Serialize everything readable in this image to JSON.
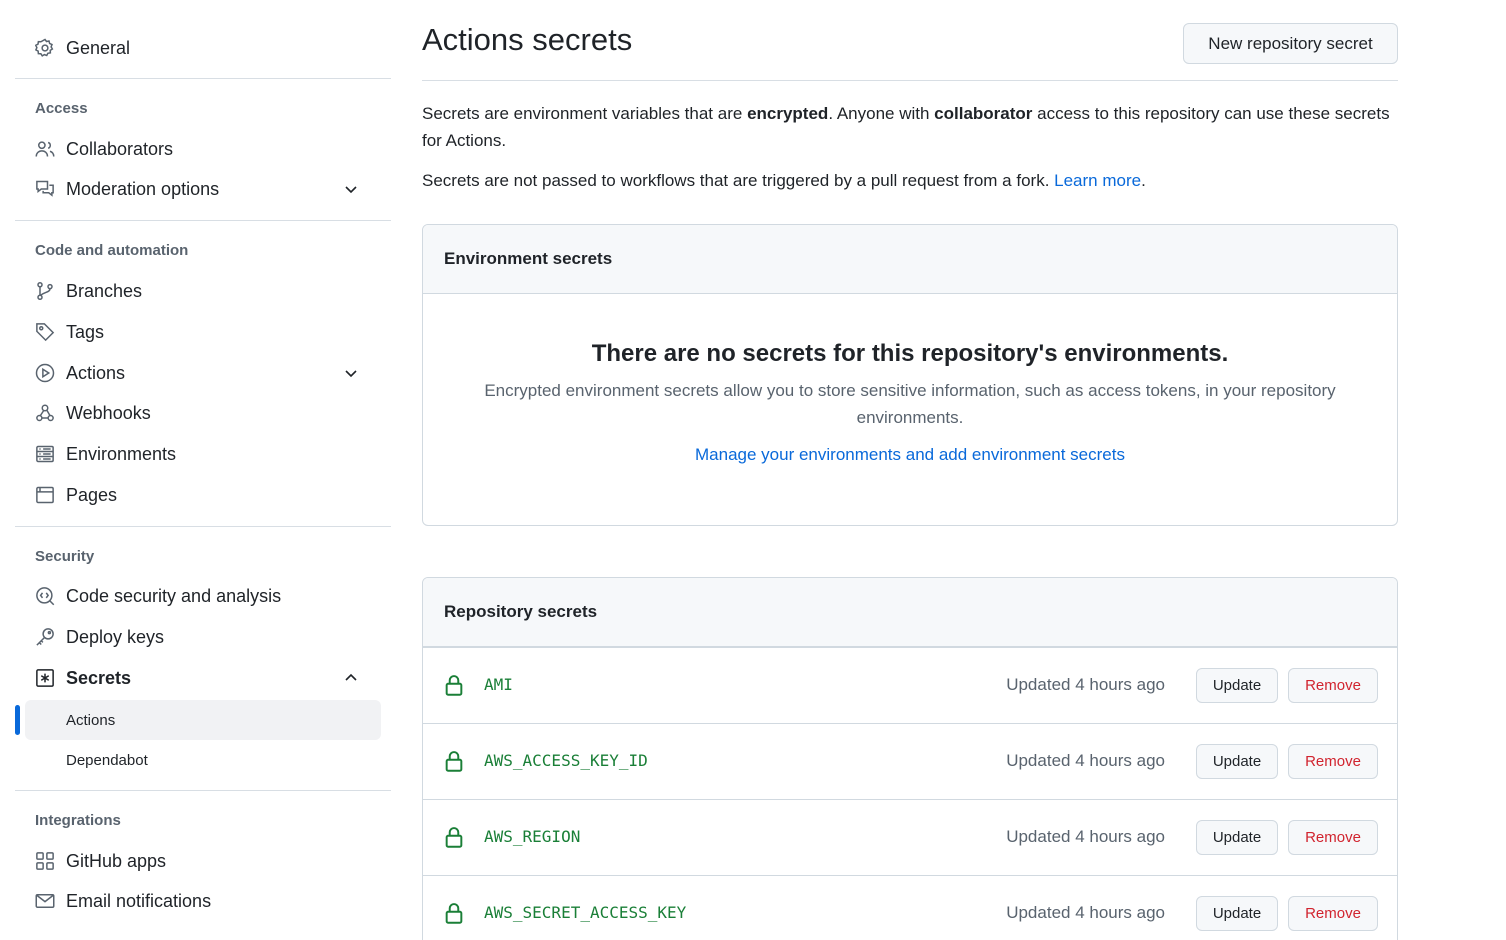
{
  "sidebar": {
    "general": "General",
    "access_head": "Access",
    "collaborators": "Collaborators",
    "moderation": "Moderation options",
    "code_head": "Code and automation",
    "branches": "Branches",
    "tags": "Tags",
    "actions": "Actions",
    "webhooks": "Webhooks",
    "environments": "Environments",
    "pages": "Pages",
    "security_head": "Security",
    "code_security": "Code security and analysis",
    "deploy_keys": "Deploy keys",
    "secrets": "Secrets",
    "secrets_actions": "Actions",
    "secrets_dependabot": "Dependabot",
    "integrations_head": "Integrations",
    "github_apps": "GitHub apps",
    "email_notifications": "Email notifications"
  },
  "header": {
    "title": "Actions secrets",
    "new_secret_button": "New repository secret"
  },
  "intro": {
    "p1_a": "Secrets are environment variables that are ",
    "p1_b": "encrypted",
    "p1_c": ". Anyone with ",
    "p1_d": "collaborator",
    "p1_e": " access to this repository can use these secrets for Actions.",
    "p2_a": "Secrets are not passed to workflows that are triggered by a pull request from a fork. ",
    "p2_link": "Learn more",
    "p2_end": "."
  },
  "env_secrets": {
    "title": "Environment secrets",
    "blank_title": "There are no secrets for this repository's environments.",
    "blank_desc": "Encrypted environment secrets allow you to store sensitive information, such as access tokens, in your repository environments.",
    "manage_link": "Manage your environments and add environment secrets"
  },
  "repo_secrets": {
    "title": "Repository secrets",
    "update_label": "Update",
    "remove_label": "Remove",
    "items": [
      {
        "name": "AMI",
        "updated": "Updated 4 hours ago"
      },
      {
        "name": "AWS_ACCESS_KEY_ID",
        "updated": "Updated 4 hours ago"
      },
      {
        "name": "AWS_REGION",
        "updated": "Updated 4 hours ago"
      },
      {
        "name": "AWS_SECRET_ACCESS_KEY",
        "updated": "Updated 4 hours ago"
      }
    ]
  },
  "icons": {
    "general": "gear-icon",
    "collaborators": "people-icon",
    "moderation": "comment-discussion-icon",
    "branches": "git-branch-icon",
    "tags": "tag-icon",
    "actions": "play-icon",
    "webhooks": "webhook-icon",
    "environments": "server-icon",
    "pages": "browser-icon",
    "code_security": "codescan-icon",
    "deploy_keys": "key-icon",
    "secrets": "key-asterisk-icon",
    "github_apps": "apps-icon",
    "email_notifications": "mail-icon",
    "secret_row": "lock-icon"
  },
  "colors": {
    "accent": "#0969da",
    "secret_name": "#1a7f37",
    "remove": "#d1242f",
    "muted": "#59636e"
  }
}
